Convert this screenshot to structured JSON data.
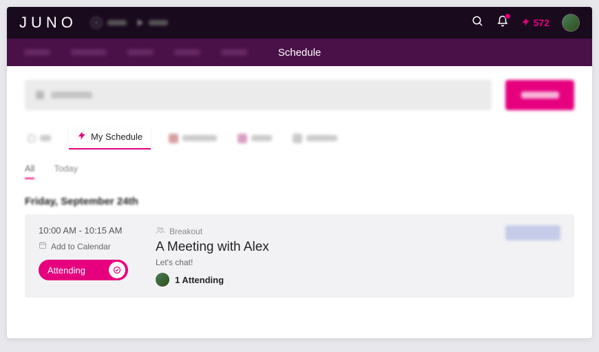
{
  "brand": "JUNO",
  "points": "572",
  "nav": {
    "active": "Schedule"
  },
  "tabs": {
    "my_schedule": "My Schedule"
  },
  "subtabs": {
    "all": "All",
    "today": "Today"
  },
  "date_header": "Friday, September 24th",
  "event": {
    "time": "10:00 AM - 10:15 AM",
    "add_cal": "Add to Calendar",
    "attending_label": "Attending",
    "tag": "Breakout",
    "title": "A Meeting with Alex",
    "desc": "Let's chat!",
    "attendee_count": "1 Attending"
  }
}
